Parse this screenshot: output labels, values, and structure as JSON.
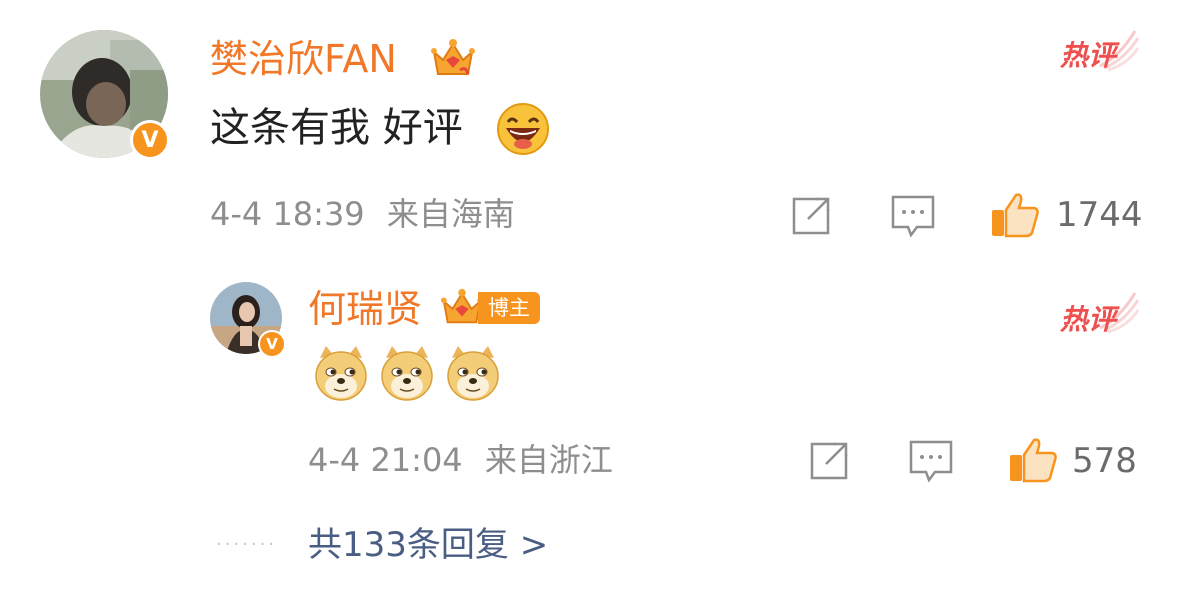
{
  "comment": {
    "username": "樊治欣FAN",
    "text": "这条有我 好评",
    "emoji": "grinning-face",
    "hot_label": "热评",
    "time": "4-4 18:39",
    "location": "来自海南",
    "like_count": "1744"
  },
  "reply": {
    "username": "何瑞贤",
    "badge": "博主",
    "emoji": [
      "doge",
      "doge",
      "doge"
    ],
    "hot_label": "热评",
    "time": "4-4 21:04",
    "location": "来自浙江",
    "like_count": "578"
  },
  "replies_link": {
    "text": "共133条回复 >"
  },
  "colors": {
    "username": "#f07828",
    "hot": "#ee4f4f",
    "meta": "#8e8e8e",
    "link": "#4a5d82",
    "like_icon": "#f7941d"
  }
}
